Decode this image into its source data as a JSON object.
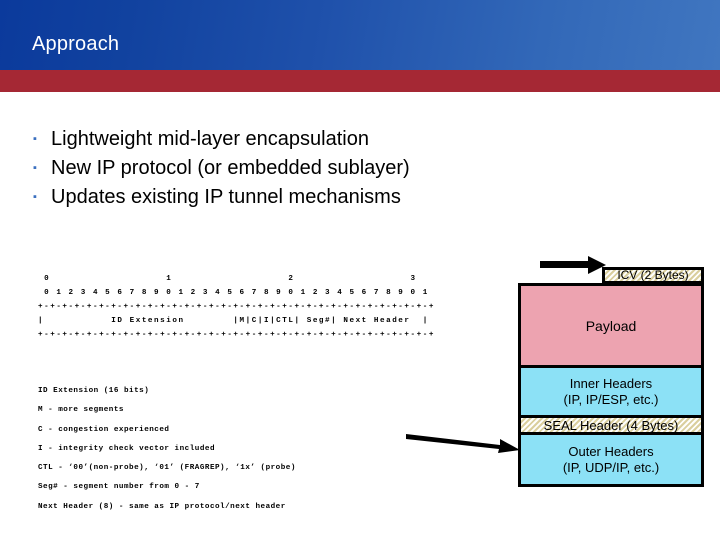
{
  "slide": {
    "title": "Approach",
    "accent_blue": "#11429f",
    "accent_red": "#a52834"
  },
  "bullets": [
    {
      "marker": "▪",
      "text": "Lightweight mid-layer encapsulation"
    },
    {
      "marker": "▪",
      "text": "New IP protocol (or embedded sublayer)"
    },
    {
      "marker": "▪",
      "text": "Updates existing IP tunnel mechanisms"
    }
  ],
  "packet_diagram": {
    "lines": [
      " 0                   1                   2                   3",
      " 0 1 2 3 4 5 6 7 8 9 0 1 2 3 4 5 6 7 8 9 0 1 2 3 4 5 6 7 8 9 0 1",
      "+-+-+-+-+-+-+-+-+-+-+-+-+-+-+-+-+-+-+-+-+-+-+-+-+-+-+-+-+-+-+-+-+",
      "|           ID Extension        |M|C|I|CTL| Seg#| Next Header  |",
      "+-+-+-+-+-+-+-+-+-+-+-+-+-+-+-+-+-+-+-+-+-+-+-+-+-+-+-+-+-+-+-+-+"
    ]
  },
  "legend": {
    "lines": [
      "ID Extension (16 bits)",
      "M - more segments",
      "C - congestion experienced",
      "I - integrity check vector included",
      "CTL - ‘00’(non-probe), ‘01’ (FRAGREP), ‘1x’ (probe)",
      "Seg# - segment number from 0 - 7",
      "Next Header (8) - same as IP protocol/next header"
    ]
  },
  "packet_stack": {
    "icv": {
      "label": "ICV (2 Bytes)",
      "color": "#f3ecc9"
    },
    "payload": {
      "label": "Payload",
      "color": "#eda3b0"
    },
    "inner_headers": {
      "line1": "Inner Headers",
      "line2": "(IP, IP/ESP, etc.)",
      "color": "#8ce1f6"
    },
    "seal_header": {
      "label": "SEAL Header (4 Bytes)",
      "color": "#f3ecc9"
    },
    "outer_headers": {
      "line1": "Outer Headers",
      "line2": "(IP, UDP/IP, etc.)",
      "color": "#8ce1f6"
    }
  }
}
